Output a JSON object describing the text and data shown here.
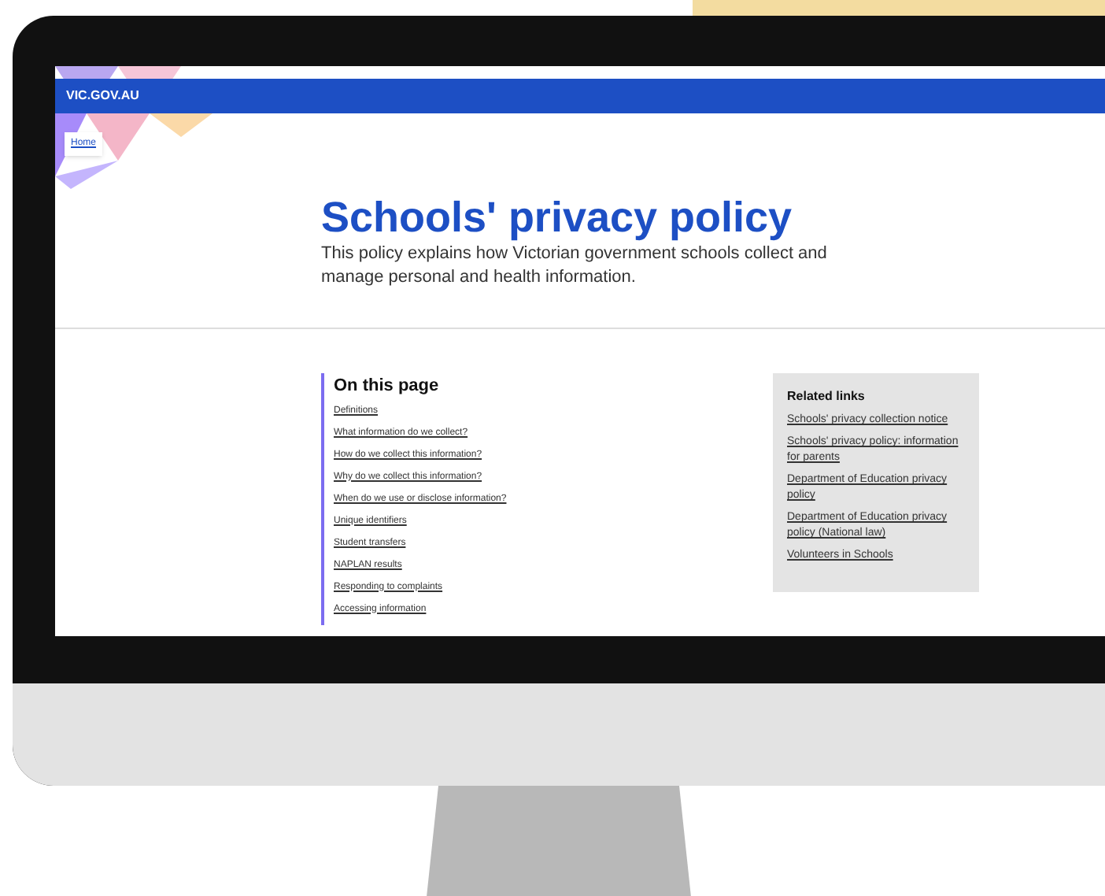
{
  "site_header": {
    "brand": "VIC.GOV.AU"
  },
  "breadcrumb": {
    "label": "Home"
  },
  "hero": {
    "title": "Schools' privacy policy",
    "summary": "This policy explains how Victorian government schools collect and manage personal and health information."
  },
  "on_this_page": {
    "heading": "On this page",
    "links": [
      "Definitions",
      "What information do we collect?",
      "How do we collect this information?",
      "Why do we collect this information?",
      "When do we use or disclose information?",
      "Unique identifiers",
      "Student transfers",
      "NAPLAN results",
      "Responding to complaints",
      "Accessing information"
    ]
  },
  "related_links": {
    "heading": "Related links",
    "links": [
      "Schools' privacy collection notice",
      "Schools' privacy policy: information for parents",
      "Department of Education privacy policy",
      "Department of Education privacy policy (National law)",
      "Volunteers in Schools"
    ]
  }
}
